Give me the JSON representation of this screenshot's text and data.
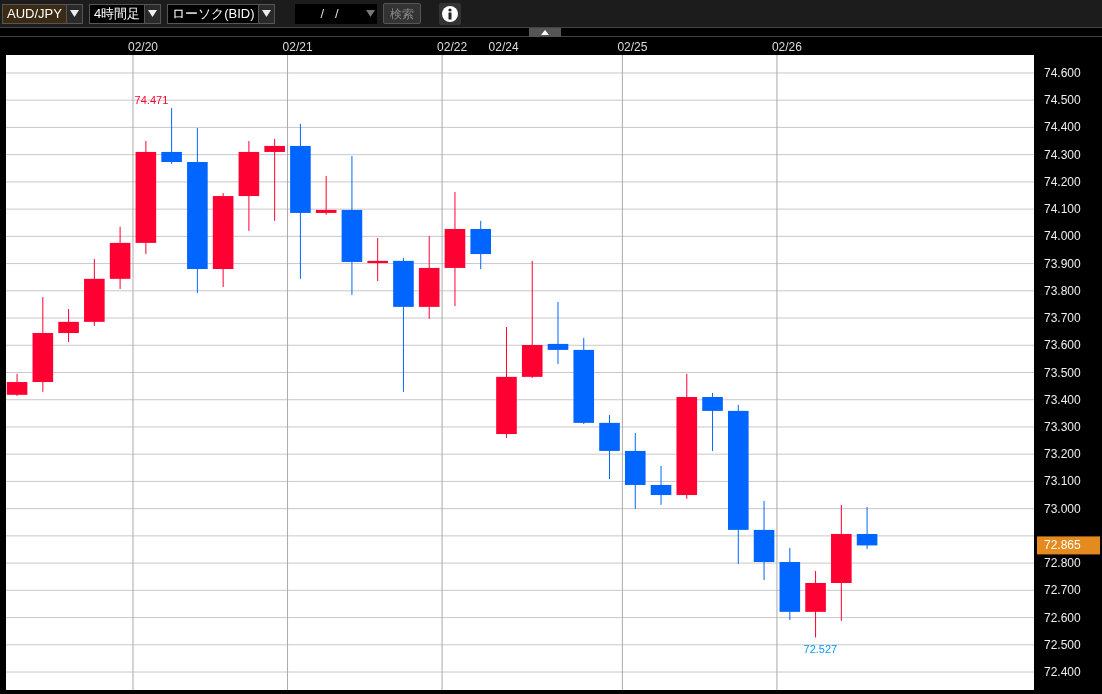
{
  "toolbar": {
    "symbol": {
      "value": "AUD/JPY"
    },
    "interval": {
      "value": "4時間足"
    },
    "chart_type": {
      "value": "ローソク(BID)"
    },
    "date": {
      "value": "/   /"
    },
    "search_button": {
      "label": "検索",
      "disabled": true
    }
  },
  "chart": {
    "date_labels": [
      "02/20",
      "02/21",
      "02/22",
      "02/24",
      "02/25",
      "02/26"
    ],
    "price_labels": [
      "74.600",
      "74.500",
      "74.400",
      "74.300",
      "74.200",
      "74.100",
      "74.000",
      "73.900",
      "73.800",
      "73.700",
      "73.600",
      "73.500",
      "73.400",
      "73.300",
      "73.200",
      "73.100",
      "73.000",
      "72.800",
      "72.700",
      "72.600",
      "72.500",
      "72.400"
    ],
    "high_label": "74.471",
    "low_label": "72.527",
    "current_price": "72.865"
  }
}
